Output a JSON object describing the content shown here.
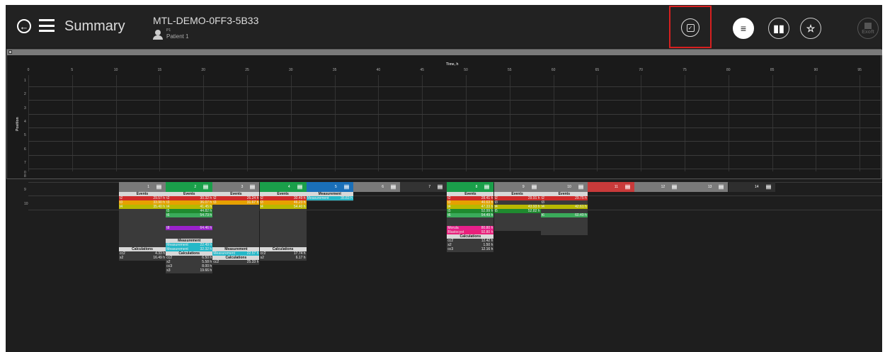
{
  "header": {
    "title": "Summary",
    "device_id": "MTL-DEMO-0FF3-5B33",
    "patient_id": "P1",
    "patient_name": "Patient 1",
    "export_label": "Exoft"
  },
  "chart": {
    "x_title": "Time, h",
    "y_title": "Position",
    "x_ticks": [
      "0",
      "5",
      "10",
      "15",
      "20",
      "25",
      "30",
      "35",
      "40",
      "45",
      "50",
      "55",
      "60",
      "65",
      "70",
      "75",
      "80",
      "85",
      "90",
      "95"
    ],
    "y_ticks": [
      "1",
      "2",
      "3",
      "4",
      "5",
      "6",
      "7",
      "8",
      "9",
      "10",
      "0"
    ]
  },
  "wells": [
    {
      "num": "1",
      "color": "#7a7a7a",
      "sections": [
        {
          "title": "Events",
          "rows": [
            [
              "t2",
              "29.57 h",
              "#d02b2b"
            ],
            [
              "t3",
              "33.90 h",
              "#e6a100"
            ],
            [
              "t4",
              "35.40 h",
              "#b8b800"
            ]
          ]
        },
        {
          "spacer": 9
        },
        {
          "title": "Calculations",
          "rows": [
            [
              "cc2",
              "4.33 h",
              ""
            ],
            [
              "s2",
              "16.49 h",
              ""
            ]
          ]
        }
      ]
    },
    {
      "num": "2",
      "color": "#1a9f4a",
      "sections": [
        {
          "title": "Events",
          "rows": [
            [
              "t2",
              "30.32 h",
              "#d02b2b"
            ],
            [
              "t3",
              "36.07 h",
              "#e6a100"
            ],
            [
              "t4",
              "41.45 h",
              "#b8b800"
            ],
            [
              "t5",
              "44.82 h",
              "#1f8a2f"
            ],
            [
              "t6",
              "54.73 h",
              "#3aaa5a"
            ]
          ]
        },
        {
          "spacer": 2
        },
        {
          "title": "",
          "rows": [
            [
              "t8",
              "64.46 h",
              "#9a22cc"
            ]
          ]
        },
        {
          "spacer": 2
        },
        {
          "title": "Measurement",
          "rows": [
            [
              "Measurement",
              "22.49 h",
              "#25b8c8"
            ],
            [
              "Measurement",
              "32.32 h",
              "#25b8c8"
            ]
          ]
        },
        {
          "title": "Calculations",
          "rows": [
            [
              "cc2",
              "6.50 h",
              ""
            ],
            [
              "s2",
              "5.58 h",
              ""
            ],
            [
              "cc3",
              "8.00 h",
              ""
            ],
            [
              "s3",
              "19.66 h",
              ""
            ]
          ]
        }
      ]
    },
    {
      "num": "3",
      "color": "#7a7a7a",
      "sections": [
        {
          "title": "Events",
          "rows": [
            [
              "t2",
              "26.24 h",
              "#d02b2b"
            ],
            [
              "t3",
              "31.67 h",
              "#e6a100"
            ]
          ]
        },
        {
          "spacer": 10
        },
        {
          "title": "Measurement",
          "rows": [
            [
              "Measurement",
              "22.57 h",
              "#25b8c8"
            ]
          ]
        },
        {
          "title": "Calculations",
          "rows": [
            [
              "cc2",
              "25.33 h",
              ""
            ]
          ]
        }
      ]
    },
    {
      "num": "4",
      "color": "#1a9f4a",
      "sections": [
        {
          "title": "Events",
          "rows": [
            [
              "t2",
              "30.49 h",
              "#d02b2b"
            ],
            [
              "t3",
              "46.23 h",
              "#e6a100"
            ],
            [
              "t4",
              "54.40 h",
              "#b8b800"
            ]
          ]
        },
        {
          "spacer": 9
        },
        {
          "title": "Calculations",
          "rows": [
            [
              "cc2",
              "17.74 h",
              ""
            ],
            [
              "s2",
              "6.17 h",
              ""
            ]
          ]
        }
      ]
    },
    {
      "num": "5",
      "color": "#1a6fb8",
      "sections": [
        {
          "title": "Measurement",
          "rows": [
            [
              "Measurement",
              "35.83 h",
              "#25b8c8"
            ]
          ]
        }
      ]
    },
    {
      "num": "6",
      "color": "#7a7a7a",
      "sections": []
    },
    {
      "num": "7",
      "color": "#333333",
      "sections": []
    },
    {
      "num": "8",
      "color": "#1a9f4a",
      "sections": [
        {
          "title": "Events",
          "rows": [
            [
              "t2",
              "28.41 h",
              "#d02b2b"
            ],
            [
              "t3",
              "40.63 h",
              "#e6a100"
            ],
            [
              "t4",
              "47.33 h",
              "#b8b800"
            ],
            [
              "t5",
              "52.99 h",
              "#1f8a2f"
            ],
            [
              "t6",
              "54.49 h",
              "#3aaa5a"
            ]
          ]
        },
        {
          "spacer": 2
        },
        {
          "title": "",
          "rows": [
            [
              "Morula",
              "80.80 h",
              "#e8208a"
            ],
            [
              "Blastocyst",
              "92.80 h",
              "#e8207a"
            ]
          ]
        },
        {
          "title": "Calculations",
          "rows": [
            [
              "cc2",
              "12.42 h",
              ""
            ],
            [
              "s2",
              "1.50 h",
              ""
            ],
            [
              "cc3",
              "12.16 h",
              ""
            ]
          ]
        }
      ]
    },
    {
      "num": "9",
      "color": "#7a7a7a",
      "sections": [
        {
          "title": "Events",
          "rows": [
            [
              "t2",
              "29.91 h",
              "#d02b2b"
            ],
            [
              "t3",
              "",
              ""
            ],
            [
              "t4",
              "43.93 h",
              "#b8b800"
            ],
            [
              "t5",
              "52.82 h",
              "#1f8a2f"
            ]
          ]
        },
        {
          "spacer": 4
        }
      ]
    },
    {
      "num": "10",
      "color": "#7a7a7a",
      "sections": [
        {
          "title": "Events",
          "rows": [
            [
              "t2",
              "29.75 h",
              "#d02b2b"
            ],
            [
              "t3",
              "",
              ""
            ],
            [
              "t4",
              "42.61 h",
              "#b8b800"
            ],
            [
              "",
              "",
              " "
            ],
            [
              "t6",
              "60.49 h",
              "#3aaa5a"
            ]
          ]
        },
        {
          "spacer": 4
        }
      ]
    },
    {
      "num": "11",
      "color": "#c93a3a",
      "sections": []
    },
    {
      "num": "12",
      "color": "#7a7a7a",
      "sections": []
    },
    {
      "num": "13",
      "color": "#7a7a7a",
      "sections": []
    },
    {
      "num": "14",
      "color": "#2e2e2e",
      "sections": []
    }
  ]
}
